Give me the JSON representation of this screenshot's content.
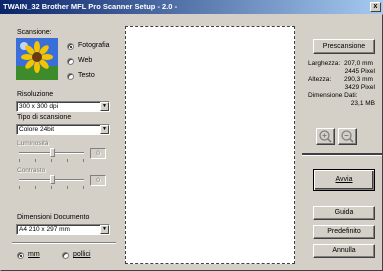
{
  "window": {
    "title": "TWAIN_32 Brother MFL Pro Scanner Setup - 2.0 -",
    "close": "x"
  },
  "scan": {
    "label": "Scansione:",
    "options": [
      {
        "label": "Fotografia",
        "selected": true
      },
      {
        "label": "Web",
        "selected": false
      },
      {
        "label": "Testo",
        "selected": false
      }
    ]
  },
  "resolution": {
    "label": "Risoluzione",
    "value": "300 x 300 dpi"
  },
  "scan_type": {
    "label": "Tipo di scansione",
    "value": "Colore 24bit"
  },
  "brightness": {
    "label": "Luminosità",
    "value": "0"
  },
  "contrast": {
    "label": "Contrasto",
    "value": "0"
  },
  "document_size": {
    "label": "Dimensioni Documento",
    "value": "A4 210 x 297 mm"
  },
  "units": {
    "mm": "mm",
    "inches": "pollici",
    "selected": "mm"
  },
  "buttons": {
    "prescan": "Prescansione",
    "start": "Avvia",
    "help": "Guida",
    "default": "Predefinito",
    "cancel": "Annulla"
  },
  "info": {
    "width_label": "Larghezza:",
    "width_mm": "207,0 mm",
    "width_px": "2445 Pixel",
    "height_label": "Altezza:",
    "height_mm": "290,3 mm",
    "height_px": "3429 Pixel",
    "data_size_label": "Dimensione Dati:",
    "data_size": "23,1 MB"
  },
  "icons": {
    "zoom_in": "zoom-in-icon",
    "zoom_out": "zoom-out-icon",
    "photo": "sunflower-photo-icon"
  }
}
